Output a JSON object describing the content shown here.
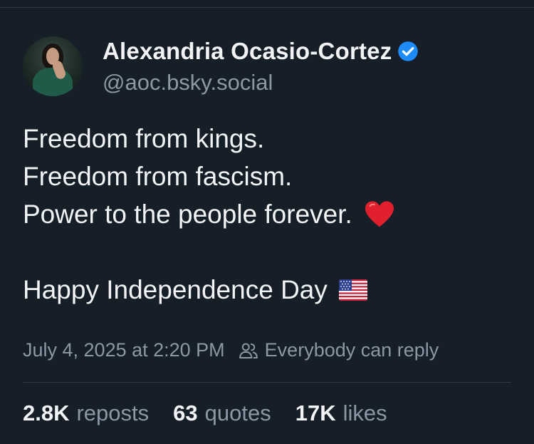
{
  "author": {
    "display_name": "Alexandria Ocasio-Cortez",
    "handle": "@aoc.bsky.social",
    "verified": true
  },
  "post": {
    "lines": [
      "Freedom from kings.",
      "Freedom from fascism.",
      "Power to the people forever.",
      "",
      "Happy Independence Day"
    ],
    "emojis": [
      "red-heart",
      "us-flag"
    ]
  },
  "meta": {
    "timestamp": "July 4, 2025 at 2:20 PM",
    "reply_setting": "Everybody can reply"
  },
  "stats": {
    "reposts_count": "2.8K",
    "reposts_label": "reposts",
    "quotes_count": "63",
    "quotes_label": "quotes",
    "likes_count": "17K",
    "likes_label": "likes"
  },
  "colors": {
    "background": "#161e27",
    "text_primary": "#f1f3f5",
    "text_secondary": "#8b98a5",
    "verified_blue": "#1d8cf8",
    "divider": "#2e3945"
  }
}
